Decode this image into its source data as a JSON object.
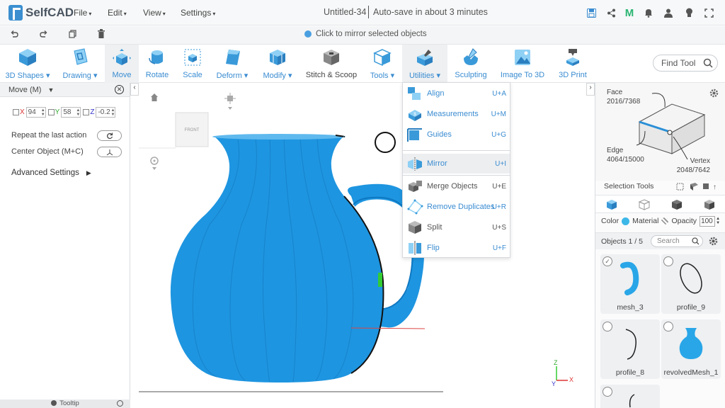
{
  "app": {
    "name": "SelfCAD"
  },
  "menubar": {
    "menus": [
      "File",
      "Edit",
      "View",
      "Settings"
    ],
    "doc_title": "Untitled-34",
    "autosave": "Auto-save in about 3 minutes",
    "icons": [
      "save-icon",
      "share-icon",
      "m-icon",
      "bell-icon",
      "user-icon",
      "lightbulb-icon",
      "fullscreen-icon"
    ]
  },
  "subbar": {
    "icons": [
      "undo-icon",
      "redo-icon",
      "copy-icon",
      "delete-icon"
    ],
    "hint": "Click to mirror selected objects"
  },
  "toolbar": {
    "tools": [
      {
        "label": "3D Shapes",
        "dropdown": true
      },
      {
        "label": "Drawing",
        "dropdown": true
      },
      {
        "label": "Move",
        "active": true
      },
      {
        "label": "Rotate"
      },
      {
        "label": "Scale"
      },
      {
        "label": "Deform",
        "dropdown": true
      },
      {
        "label": "Modify",
        "dropdown": true
      },
      {
        "label": "Stitch & Scoop"
      },
      {
        "label": "Tools",
        "dropdown": true
      },
      {
        "label": "Utilities",
        "dropdown": true,
        "active": true
      },
      {
        "label": "Sculpting"
      },
      {
        "label": "Image To 3D"
      },
      {
        "label": "3D Print"
      }
    ],
    "find_tool": "Find Tool"
  },
  "left_panel": {
    "title": "Move (M)",
    "coords": {
      "x_label": "X",
      "x": "94",
      "y_label": "Y",
      "y": "58",
      "z_label": "Z",
      "z": "-0.2"
    },
    "repeat_label": "Repeat the last action",
    "center_label": "Center Object (M+C)",
    "advanced_label": "Advanced Settings",
    "tooltip_label": "Tooltip"
  },
  "viewport": {
    "cube_label": "FRONT",
    "axis_z": "Z",
    "axis_x": "X",
    "axis_y": "Y"
  },
  "utilities_menu": {
    "items": [
      {
        "label": "Align",
        "shortcut": "U+A"
      },
      {
        "label": "Measurements",
        "shortcut": "U+M"
      },
      {
        "label": "Guides",
        "shortcut": "U+G"
      },
      {
        "label": "Mirror",
        "shortcut": "U+I",
        "highlighted": true
      },
      {
        "label": "Merge Objects",
        "shortcut": "U+E"
      },
      {
        "label": "Remove Duplicates",
        "shortcut": "U+R"
      },
      {
        "label": "Split",
        "shortcut": "U+S"
      },
      {
        "label": "Flip",
        "shortcut": "U+F"
      }
    ]
  },
  "right_panel": {
    "face_label": "Face",
    "face_count": "2016/7368",
    "edge_label": "Edge",
    "edge_count": "4064/15000",
    "vertex_label": "Vertex",
    "vertex_count": "2048/7642",
    "selection_tools_label": "Selection Tools",
    "color_label": "Color",
    "material_label": "Material",
    "opacity_label": "Opacity",
    "opacity_value": "100",
    "objects_label": "Objects 1 / 5",
    "search_placeholder": "Search",
    "objects": [
      {
        "name": "mesh_3",
        "checked": true
      },
      {
        "name": "profile_9",
        "checked": false
      },
      {
        "name": "profile_8",
        "checked": false
      },
      {
        "name": "revolvedMesh_1",
        "checked": false
      },
      {
        "name": "",
        "checked": false
      }
    ]
  },
  "colors": {
    "accent": "#3a8cd1",
    "model": "#1e95e0"
  }
}
